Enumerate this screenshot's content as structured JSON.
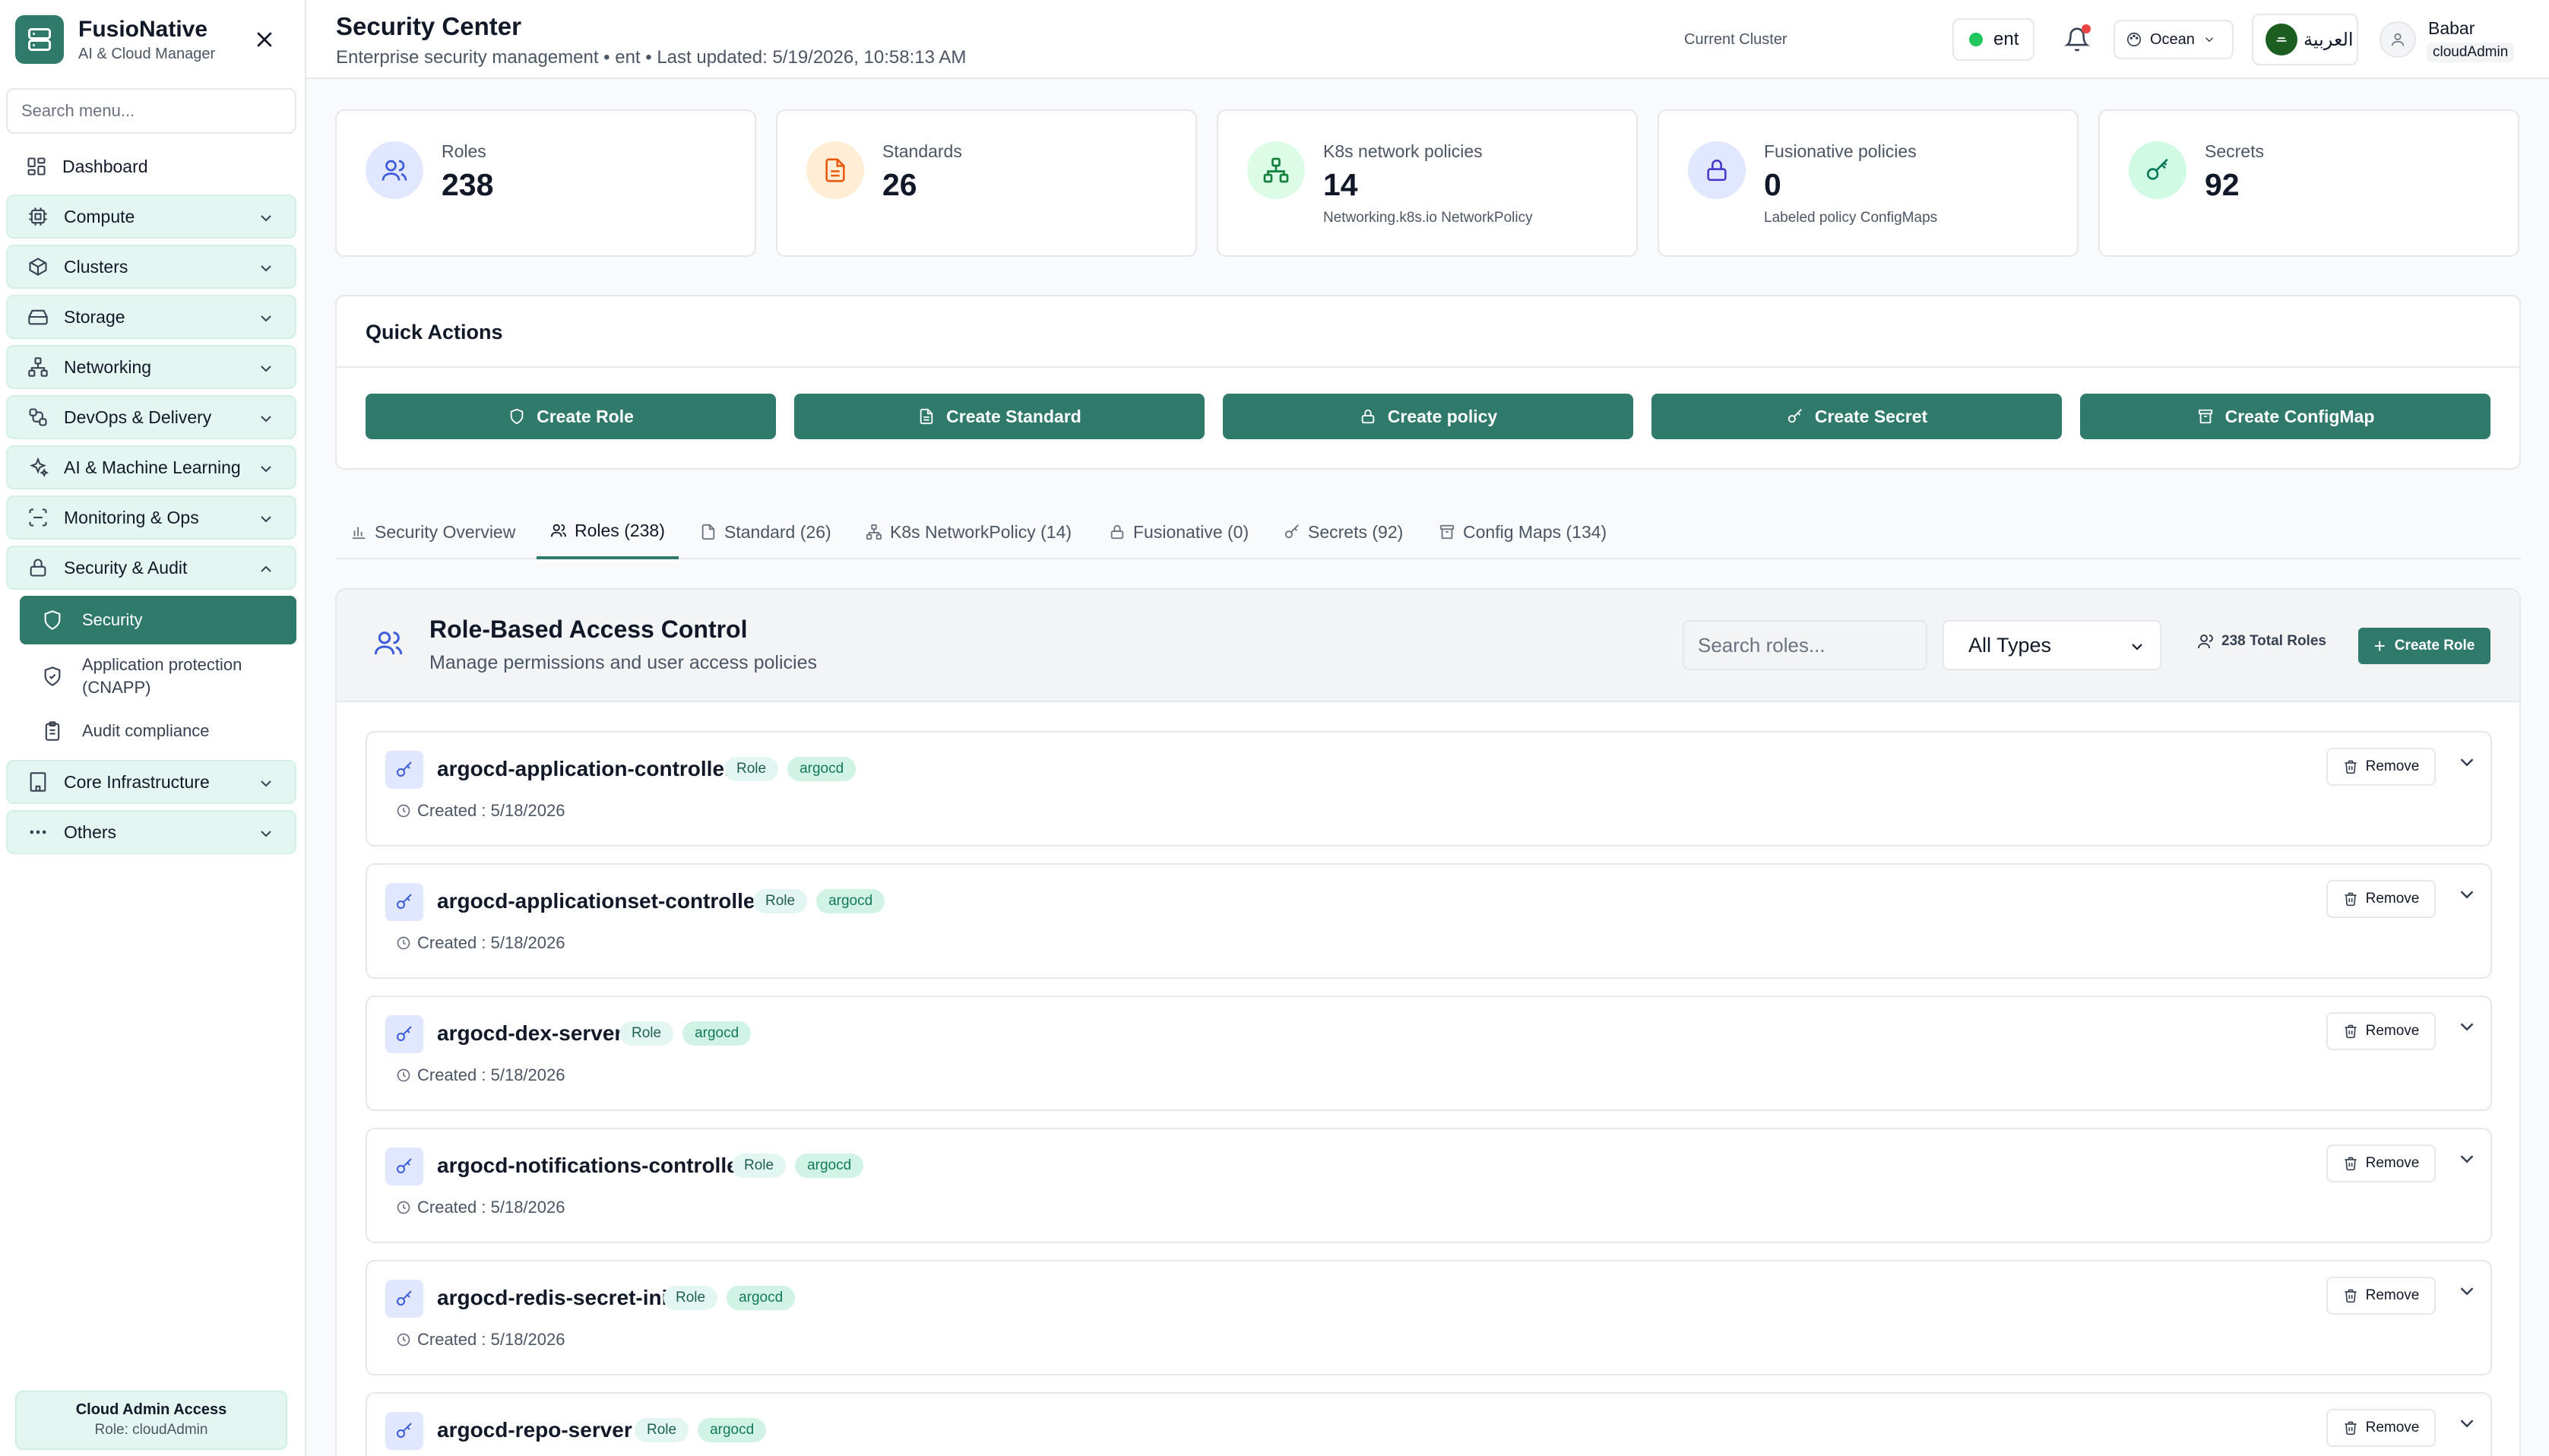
{
  "brand": {
    "name": "FusioNative",
    "subtitle": "AI & Cloud Manager"
  },
  "sidebar": {
    "search_placeholder": "Search menu...",
    "items": [
      {
        "label": "Dashboard",
        "icon": "dashboard-icon",
        "kind": "plain"
      },
      {
        "label": "Compute",
        "icon": "cpu-icon",
        "kind": "group"
      },
      {
        "label": "Clusters",
        "icon": "box-icon",
        "kind": "group"
      },
      {
        "label": "Storage",
        "icon": "hard-drive-icon",
        "kind": "group"
      },
      {
        "label": "Networking",
        "icon": "network-icon",
        "kind": "group"
      },
      {
        "label": "DevOps & Delivery",
        "icon": "git-branch-icon",
        "kind": "group"
      },
      {
        "label": "AI & Machine Learning",
        "icon": "sparkles-icon",
        "kind": "group"
      },
      {
        "label": "Monitoring & Ops",
        "icon": "scan-icon",
        "kind": "group"
      },
      {
        "label": "Security & Audit",
        "icon": "lock-icon",
        "kind": "group-open"
      }
    ],
    "security_sub": [
      {
        "label": "Security",
        "icon": "shield-icon",
        "active": true
      },
      {
        "label": "Application protection (CNAPP)",
        "icon": "shield-check-icon",
        "active": false
      },
      {
        "label": "Audit compliance",
        "icon": "clipboard-icon",
        "active": false
      }
    ],
    "items_after": [
      {
        "label": "Core Infrastructure",
        "icon": "building-icon",
        "kind": "group"
      },
      {
        "label": "Others",
        "icon": "dots-icon",
        "kind": "group"
      }
    ],
    "admin": {
      "title": "Cloud Admin Access",
      "role": "Role: cloudAdmin"
    }
  },
  "header": {
    "title": "Security Center",
    "subtitle": "Enterprise security management • ent • Last updated: 5/19/2026, 10:58:13 AM",
    "cluster_label": "Current Cluster",
    "cluster_name": "ent",
    "theme": "Ocean",
    "language": "العربية",
    "user_name": "Babar",
    "user_role": "cloudAdmin",
    "colors": {
      "status_ok": "#22c55e",
      "notification": "#ef4444"
    }
  },
  "stats": [
    {
      "label": "Roles",
      "value": "238",
      "note": "",
      "icon": "users-icon",
      "bg": "#e0e7ff",
      "fg": "#3b5bdb"
    },
    {
      "label": "Standards",
      "value": "26",
      "note": "",
      "icon": "file-text-icon",
      "bg": "#ffedd5",
      "fg": "#ea580c"
    },
    {
      "label": "K8s network policies",
      "value": "14",
      "note": "Networking.k8s.io NetworkPolicy",
      "icon": "network-icon",
      "bg": "#dcfce7",
      "fg": "#15803d"
    },
    {
      "label": "Fusionative policies",
      "value": "0",
      "note": "Labeled policy ConfigMaps",
      "icon": "lock-icon",
      "bg": "#e0e7ff",
      "fg": "#4338ca"
    },
    {
      "label": "Secrets",
      "value": "92",
      "note": "",
      "icon": "key-icon",
      "bg": "#d1fae5",
      "fg": "#047857"
    }
  ],
  "quick_actions": {
    "title": "Quick Actions",
    "buttons": [
      {
        "label": "Create Role",
        "icon": "shield-icon"
      },
      {
        "label": "Create Standard",
        "icon": "file-text-icon"
      },
      {
        "label": "Create policy",
        "icon": "lock-icon"
      },
      {
        "label": "Create Secret",
        "icon": "key-icon"
      },
      {
        "label": "Create ConfigMap",
        "icon": "archive-icon"
      }
    ],
    "accent": "#2f7a6b"
  },
  "tabs": [
    {
      "label": "Security Overview",
      "icon": "bar-chart-icon",
      "active": false
    },
    {
      "label": "Roles (238)",
      "icon": "users-icon",
      "active": true
    },
    {
      "label": "Standard (26)",
      "icon": "file-text-icon",
      "active": false
    },
    {
      "label": "K8s NetworkPolicy (14)",
      "icon": "network-icon",
      "active": false
    },
    {
      "label": "Fusionative (0)",
      "icon": "lock-icon",
      "active": false
    },
    {
      "label": "Secrets (92)",
      "icon": "key-icon",
      "active": false
    },
    {
      "label": "Config Maps (134)",
      "icon": "archive-icon",
      "active": false
    }
  ],
  "rbac": {
    "title": "Role-Based Access Control",
    "subtitle": "Manage permissions and user access policies",
    "search_placeholder": "Search roles...",
    "type_filter": "All Types",
    "total": "238 Total Roles",
    "create_label": "Create Role",
    "remove_label": "Remove",
    "roles": [
      {
        "name": "argocd-application-controller",
        "kind": "Role",
        "namespace": "argocd",
        "created": "Created : 5/18/2026"
      },
      {
        "name": "argocd-applicationset-controller",
        "kind": "Role",
        "namespace": "argocd",
        "created": "Created : 5/18/2026"
      },
      {
        "name": "argocd-dex-server",
        "kind": "Role",
        "namespace": "argocd",
        "created": "Created : 5/18/2026"
      },
      {
        "name": "argocd-notifications-controller",
        "kind": "Role",
        "namespace": "argocd",
        "created": "Created : 5/18/2026"
      },
      {
        "name": "argocd-redis-secret-init",
        "kind": "Role",
        "namespace": "argocd",
        "created": "Created : 5/18/2026"
      },
      {
        "name": "argocd-repo-server",
        "kind": "Role",
        "namespace": "argocd",
        "created": "Created : 5/18/2026"
      }
    ]
  }
}
